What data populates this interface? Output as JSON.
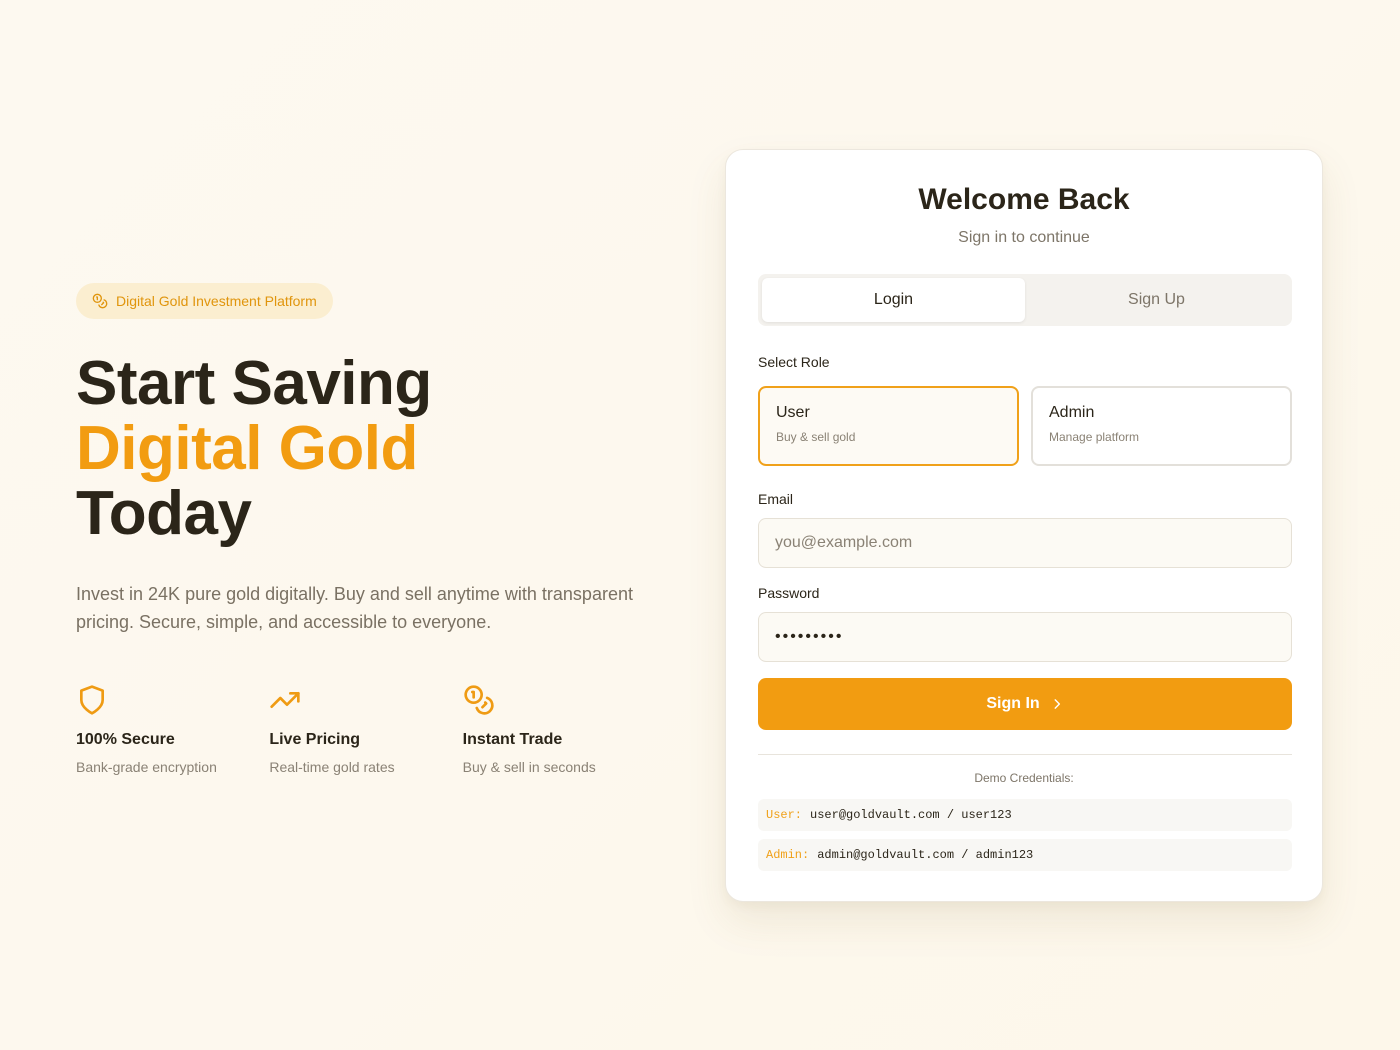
{
  "hero": {
    "badge": "Digital Gold Investment Platform",
    "headline_1": "Start Saving",
    "headline_2": "Digital Gold",
    "headline_3": "Today",
    "lede": "Invest in 24K pure gold digitally. Buy and sell anytime with transparent pricing. Secure, simple, and accessible to everyone.",
    "features": [
      {
        "icon": "shield-icon",
        "title": "100% Secure",
        "subtitle": "Bank-grade encryption"
      },
      {
        "icon": "trending-up-icon",
        "title": "Live Pricing",
        "subtitle": "Real-time gold rates"
      },
      {
        "icon": "coins-icon",
        "title": "Instant Trade",
        "subtitle": "Buy & sell in seconds"
      }
    ]
  },
  "card": {
    "title": "Welcome Back",
    "subtitle": "Sign in to continue",
    "tabs": [
      {
        "label": "Login",
        "active": true
      },
      {
        "label": "Sign Up",
        "active": false
      }
    ],
    "role_label": "Select Role",
    "roles": [
      {
        "title": "User",
        "subtitle": "Buy & sell gold",
        "selected": true
      },
      {
        "title": "Admin",
        "subtitle": "Manage platform",
        "selected": false
      }
    ],
    "email_label": "Email",
    "email_placeholder": "you@example.com",
    "email_value": "",
    "password_label": "Password",
    "password_value": "•••••••••",
    "submit_label": "Sign In",
    "demo_title": "Demo Credentials:",
    "demo": [
      {
        "key": "User:",
        "value": "user@goldvault.com / user123"
      },
      {
        "key": "Admin:",
        "value": "admin@goldvault.com / admin123"
      }
    ]
  },
  "colors": {
    "accent": "#f29c11",
    "text": "#2b2519",
    "muted": "#7d7568",
    "badge_bg": "#fbeed0"
  }
}
